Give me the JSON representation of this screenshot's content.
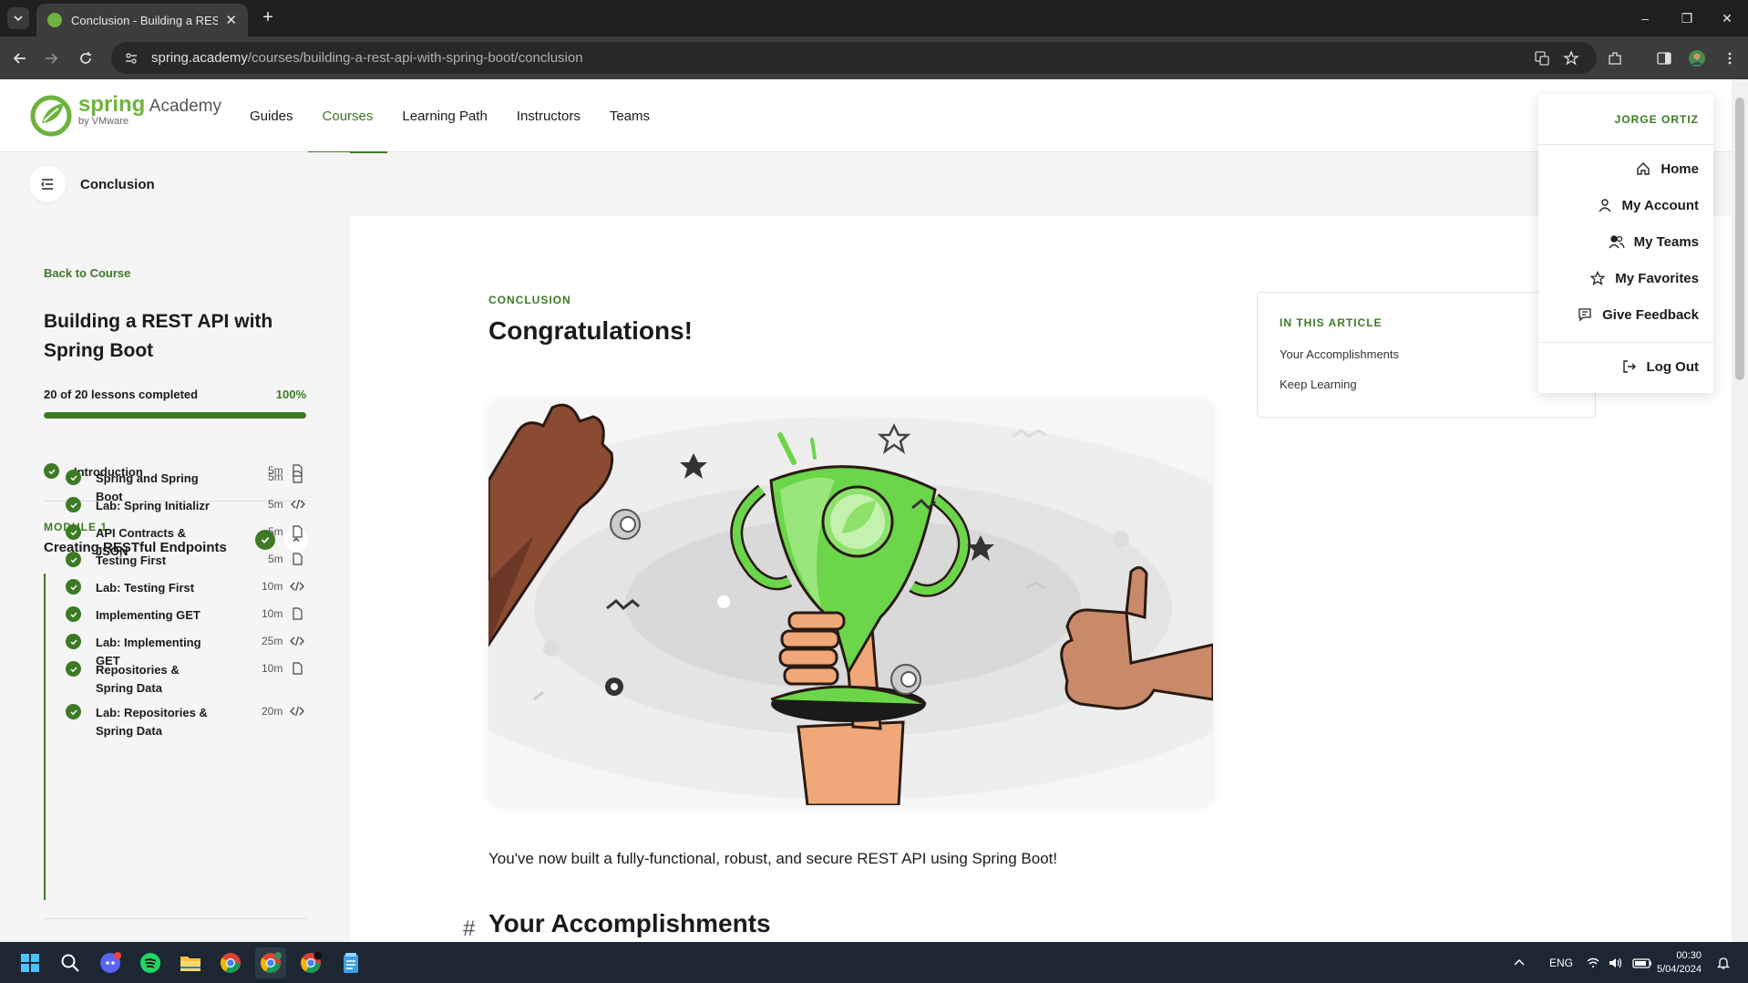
{
  "browser": {
    "tab_title": "Conclusion - Building a REST AP",
    "tab_close": "✕",
    "new_tab": "+",
    "url_host": "spring.academy",
    "url_path": "/courses/building-a-rest-api-with-spring-boot/conclusion",
    "window_controls": [
      "–",
      "❐",
      "✕"
    ]
  },
  "site": {
    "logo_spring": "spring",
    "logo_academy": "Academy",
    "logo_by": "by VMware",
    "nav": [
      "Guides",
      "Courses",
      "Learning Path",
      "Instructors",
      "Teams"
    ],
    "active_nav": "Courses",
    "accent_color": "#3c7a24",
    "brand_color": "#6db33f"
  },
  "sidebar": {
    "current_page": "Conclusion",
    "back_link": "Back to Course",
    "course_title": "Building a REST API with Spring Boot",
    "progress_text": "20 of 20 lessons completed",
    "progress_percent": "100%",
    "progress_fraction": 1.0,
    "intro": {
      "label": "Introduction",
      "duration": "5m",
      "type": "doc"
    },
    "module": {
      "label": "MODULE 1",
      "title": "Creating RESTful Endpoints",
      "lessons": [
        {
          "label": "Spring and Spring Boot",
          "duration": "5m",
          "type": "doc"
        },
        {
          "label": "Lab: Spring Initializr",
          "duration": "5m",
          "type": "code"
        },
        {
          "label": "API Contracts & JSON",
          "duration": "5m",
          "type": "doc"
        },
        {
          "label": "Testing First",
          "duration": "5m",
          "type": "doc"
        },
        {
          "label": "Lab: Testing First",
          "duration": "10m",
          "type": "code"
        },
        {
          "label": "Implementing GET",
          "duration": "10m",
          "type": "doc"
        },
        {
          "label": "Lab: Implementing GET",
          "duration": "25m",
          "type": "code"
        },
        {
          "label": "Repositories & Spring Data",
          "duration": "10m",
          "type": "doc"
        },
        {
          "label": "Lab: Repositories & Spring Data",
          "duration": "20m",
          "type": "code"
        }
      ]
    }
  },
  "article": {
    "section_label": "CONCLUSION",
    "title": "Congratulations!",
    "body": "You've now built a fully-functional, robust, and secure REST API using Spring Boot!",
    "heading_hash": "#",
    "heading": "Your Accomplishments"
  },
  "toc": {
    "heading": "IN THIS ARTICLE",
    "items": [
      "Your Accomplishments",
      "Keep Learning"
    ]
  },
  "user_menu": {
    "user_name": "JORGE ORTIZ",
    "items": [
      {
        "label": "Home",
        "icon": "home-icon"
      },
      {
        "label": "My Account",
        "icon": "user-icon"
      },
      {
        "label": "My Teams",
        "icon": "team-icon"
      },
      {
        "label": "My Favorites",
        "icon": "star-icon"
      },
      {
        "label": "Give Feedback",
        "icon": "feedback-icon"
      }
    ],
    "logout": {
      "label": "Log Out",
      "icon": "logout-icon"
    }
  },
  "taskbar": {
    "apps": [
      "windows-start-icon",
      "search-icon",
      "discord-icon",
      "spotify-icon",
      "file-explorer-icon",
      "chrome-icon",
      "chrome-icon",
      "chrome-icon",
      "notepad-icon"
    ],
    "language": "ENG",
    "time": "00:30",
    "date": "5/04/2024"
  }
}
